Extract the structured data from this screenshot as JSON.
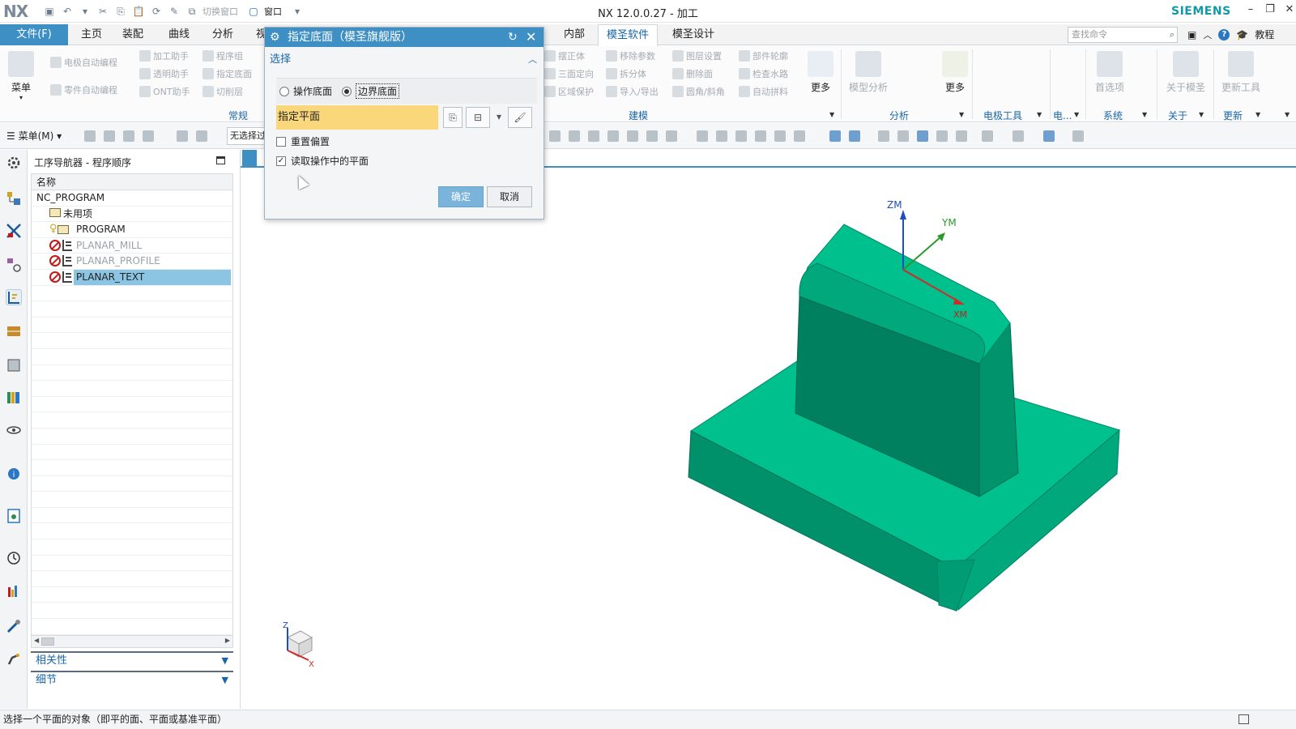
{
  "app": {
    "window_title": "NX 12.0.0.27 - 加工",
    "logo": "NX",
    "brand": "SIEMENS",
    "quick_access": {
      "switch_window": "切换窗口",
      "window": "窗口"
    }
  },
  "ribbon_tabs": {
    "file": "文件(F)",
    "items": [
      "主页",
      "装配",
      "曲线",
      "分析",
      "视"
    ],
    "right_items": [
      "内部",
      "模圣软件",
      "模圣设计"
    ],
    "active": "模圣软件",
    "search_placeholder": "查找命令",
    "tutorial": "教程"
  },
  "ribbon": {
    "left_group": {
      "big_button": "菜单",
      "items": [
        "电极自动编程",
        "加工助手",
        "程序组",
        "零件自动编程",
        "透明助手",
        "指定底面",
        "ONT助手",
        "切削层"
      ],
      "label": "常规"
    },
    "modeling_group": {
      "items": [
        "摆正体",
        "移除参数",
        "图层设置",
        "部件轮廓",
        "三面定向",
        "拆分体",
        "删除面",
        "检查水路",
        "区域保护",
        "导入/导出",
        "圆角/斜角",
        "自动拼料"
      ],
      "more": "更多",
      "label": "建模"
    },
    "analysis_group": {
      "big_button": "模型分析",
      "more": "更多",
      "label": "分析"
    },
    "electrode_group": {
      "label": "电极工具"
    },
    "electrode_short": {
      "label": "电..."
    },
    "system_group": {
      "big_button": "首选项",
      "label": "系统"
    },
    "about_group": {
      "big_button": "关于模圣",
      "label": "关于"
    },
    "update_group": {
      "big_button": "更新工具",
      "label": "更新"
    }
  },
  "toolbar": {
    "menu": "菜单(M)",
    "filter_value": "无选择过"
  },
  "navigator": {
    "title": "工序导航器 - 程序顺序",
    "column_name": "名称",
    "rows": [
      {
        "label": "NC_PROGRAM"
      },
      {
        "label": "未用项"
      },
      {
        "label": "PROGRAM"
      },
      {
        "label": "PLANAR_MILL"
      },
      {
        "label": "PLANAR_PROFILE"
      },
      {
        "label": "PLANAR_TEXT"
      }
    ],
    "selected": "PLANAR_TEXT",
    "panels": [
      "相关性",
      "细节"
    ]
  },
  "dialog": {
    "title": "指定底面（模圣旗舰版）",
    "group_label": "选择",
    "radio_options": [
      "操作底面",
      "边界底面"
    ],
    "radio_selected": "边界底面",
    "specify_plane": "指定平面",
    "checkboxes": [
      {
        "label": "重置偏置",
        "checked": false
      },
      {
        "label": "读取操作中的平面",
        "checked": true
      }
    ],
    "ok_label": "确定",
    "cancel_label": "取消"
  },
  "viewport": {
    "axis_labels": {
      "zm": "ZM",
      "ym": "YM",
      "xm": "XM"
    },
    "triad_labels": {
      "z": "Z",
      "x": "X"
    },
    "model_color": "#00b386"
  },
  "status_bar": {
    "message": "选择一个平面的对象（即平的面、平面或基准平面）"
  },
  "colors": {
    "accent": "#3d8fc4",
    "selection": "#8cc5e3",
    "highlight_field": "#f9d77a",
    "brand": "#1199aa"
  }
}
